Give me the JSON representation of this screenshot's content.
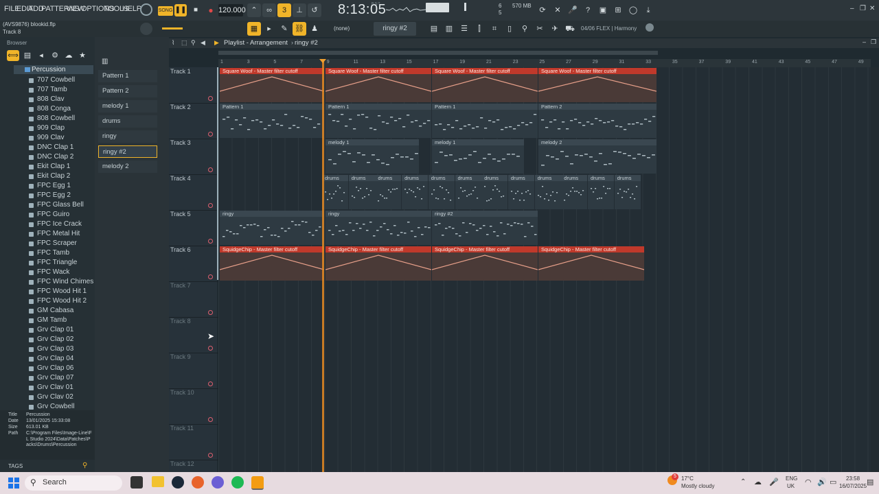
{
  "menu": [
    "FILE",
    "EDIT",
    "ADD",
    "PATTERNS",
    "VIEW",
    "OPTIONS",
    "TOOLS",
    "HELP"
  ],
  "transport": {
    "song_label": "SONG",
    "tempo": "120.000",
    "time": "8:13:05",
    "time_label": "B:S:T",
    "mem": "570 MB",
    "cpu_a": "6",
    "cpu_b": "5"
  },
  "project": {
    "file": "(AVS9876) blookid.flp",
    "hint": "Track 8"
  },
  "toolbar2": {
    "pattern_selector": "ringy #2",
    "none_label": "(none)",
    "news": "04/06  FLEX | Harmony"
  },
  "playlist": {
    "title": "Playlist - Arrangement",
    "pattern": "ringy #2"
  },
  "browser": {
    "title": "Browser",
    "folder": "Percussion",
    "items": [
      "707 Cowbell",
      "707 Tamb",
      "808 Clav",
      "808 Conga",
      "808 Cowbell",
      "909 Clap",
      "909 Clav",
      "DNC Clap 1",
      "DNC Clap 2",
      "Ekit Clap 1",
      "Ekit Clap 2",
      "FPC Egg 1",
      "FPC Egg 2",
      "FPC Glass Bell",
      "FPC Guiro",
      "FPC Ice Crack",
      "FPC Metal Hit",
      "FPC Scraper",
      "FPC Tamb",
      "FPC Triangle",
      "FPC Wack",
      "FPC Wind Chimes",
      "FPC Wood Hit 1",
      "FPC Wood Hit 2",
      "GM Cabasa",
      "GM Tamb",
      "Grv Clap 01",
      "Grv Clap 02",
      "Grv Clap 03",
      "Grv Clap 04",
      "Grv Clap 06",
      "Grv Clap 07",
      "Grv Clav 01",
      "Grv Clav 02",
      "Grv Cowbell"
    ],
    "info": {
      "title_label": "Title",
      "title": "Percussion",
      "date_label": "Date",
      "date": "13/01/2025 15:33:08",
      "size_label": "Size",
      "size": "613.01 KB",
      "path_label": "Path",
      "path": "C:\\Program Files\\Image-Line\\FL Studio 2024\\Data\\Patches\\Packs\\Drums\\Percussion"
    },
    "tags": "TAGS"
  },
  "patterns": [
    "Pattern 1",
    "Pattern 2",
    "melody 1",
    "drums",
    "ringy",
    "ringy #2",
    "melody 2"
  ],
  "tracks": [
    "Track 1",
    "Track 2",
    "Track 3",
    "Track 4",
    "Track 5",
    "Track 6",
    "Track 7",
    "Track 8",
    "Track 9",
    "Track 10",
    "Track 11",
    "Track 12"
  ],
  "ruler": [
    "1",
    "3",
    "5",
    "7",
    "9",
    "11",
    "13",
    "15",
    "17",
    "19",
    "21",
    "23",
    "25",
    "27",
    "29",
    "31",
    "33",
    "35",
    "37",
    "39",
    "41",
    "43",
    "45",
    "47",
    "49"
  ],
  "clips": {
    "t1": [
      "Square Woof - Master filter cutoff",
      "Square Woof - Master filter cutoff",
      "Square Woof - Master filter cutoff",
      "Square Woof - Master filter cutoff"
    ],
    "t2": [
      "Pattern 1",
      "Pattern 1",
      "Pattern 1",
      "Pattern 2"
    ],
    "t3": [
      "melody 1",
      "melody 1",
      "melody 2"
    ],
    "t4": [
      "drums",
      "drums",
      "drums",
      "drums",
      "drums",
      "drums",
      "drums",
      "drums",
      "drums",
      "drums",
      "drums",
      "drums"
    ],
    "t5": [
      "ringy",
      "ringy",
      "ringy #2"
    ],
    "t6": [
      "SquidgeChip - Master filter cutoff",
      "SquidgeChip - Master filter cutoff",
      "SquidgeChip - Master filter cutoff",
      "SquidgeChip - Master filter cutoff"
    ]
  },
  "taskbar": {
    "search": "Search",
    "weather_temp": "17°C",
    "weather_desc": "Mostly cloudy",
    "lang": "ENG",
    "region": "UK",
    "clock": "23:58",
    "date": "16/07/2025",
    "badge": "5"
  }
}
